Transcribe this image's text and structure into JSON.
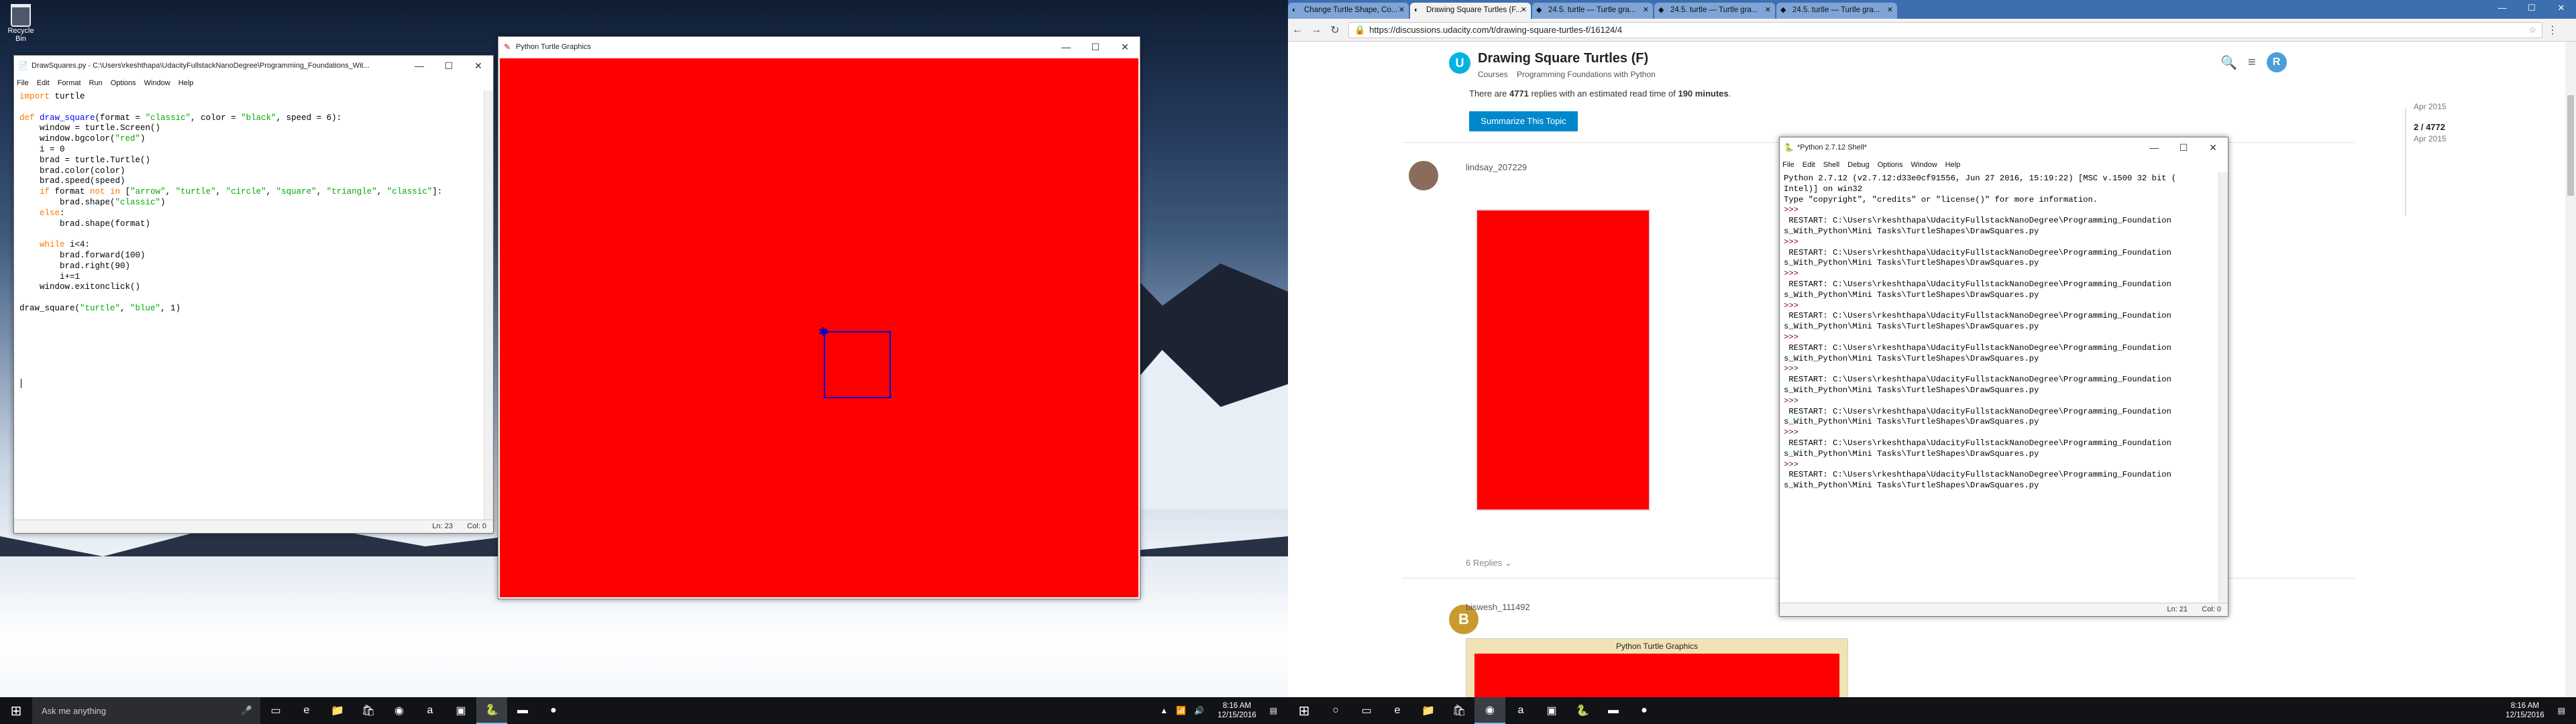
{
  "desktop": {
    "recycle_bin_label": "Recycle Bin"
  },
  "editor": {
    "title": "DrawSquares.py - C:\\Users\\rkeshthapa\\UdacityFullstackNanoDegree\\Programming_Foundations_Wit...",
    "menu": [
      "File",
      "Edit",
      "Format",
      "Run",
      "Options",
      "Window",
      "Help"
    ],
    "status_line": "Ln: 23",
    "status_col": "Col: 0"
  },
  "turtle_window": {
    "title": "Python Turtle Graphics",
    "canvas_color": "#ff0000",
    "pen_color": "#0000cc"
  },
  "shell": {
    "title": "*Python 2.7.12 Shell*",
    "menu": [
      "File",
      "Edit",
      "Shell",
      "Debug",
      "Options",
      "Window",
      "Help"
    ],
    "banner_1": "Python 2.7.12 (v2.7.12:d33e0cf91556, Jun 27 2016, 15:19:22) [MSC v.1500 32 bit (",
    "banner_2": "Intel)] on win32",
    "banner_3": "Type \"copyright\", \"credits\" or \"license()\" for more information.",
    "prompt": ">>>",
    "restart_1": " RESTART: C:\\Users\\rkeshthapa\\UdacityFullstackNanoDegree\\Programming_Foundation",
    "restart_2": "s_With_Python\\Mini Tasks\\TurtleShapes\\DrawSquares.py",
    "status_line": "Ln: 21",
    "status_col": "Col: 0"
  },
  "chrome": {
    "tabs": [
      "Change Turtle Shape, Co...",
      "Drawing Square Turtles (F...",
      "24.5. turtle — Turtle gra...",
      "24.5. turtle — Turtle gra...",
      "24.5. turtle — Turtle gra..."
    ],
    "url": "https://discussions.udacity.com/t/drawing-square-turtles-f/16124/4"
  },
  "discourse": {
    "topic_title": "Drawing Square Turtles (F)",
    "crumb_1": "Courses",
    "crumb_2": "Programming Foundations with Python",
    "summary_pre": "There are ",
    "summary_count": "4771",
    "summary_mid": " replies with an estimated read time of ",
    "summary_time": "190 minutes",
    "summary_post": ".",
    "summary_button": "Summarize This Topic",
    "user_1": "lindsay_207229",
    "replies_link": "6 Replies",
    "user_2": "biswesh_111492",
    "embedded_title": "Python Turtle Graphics",
    "timeline_date": "Apr 2015",
    "timeline_pos": "2 / 4772",
    "timeline_sub": "Apr 2015",
    "header_avatar": "R"
  },
  "taskbar": {
    "search_placeholder": "Ask me anything",
    "time": "8:16 AM",
    "date": "12/15/2016"
  }
}
